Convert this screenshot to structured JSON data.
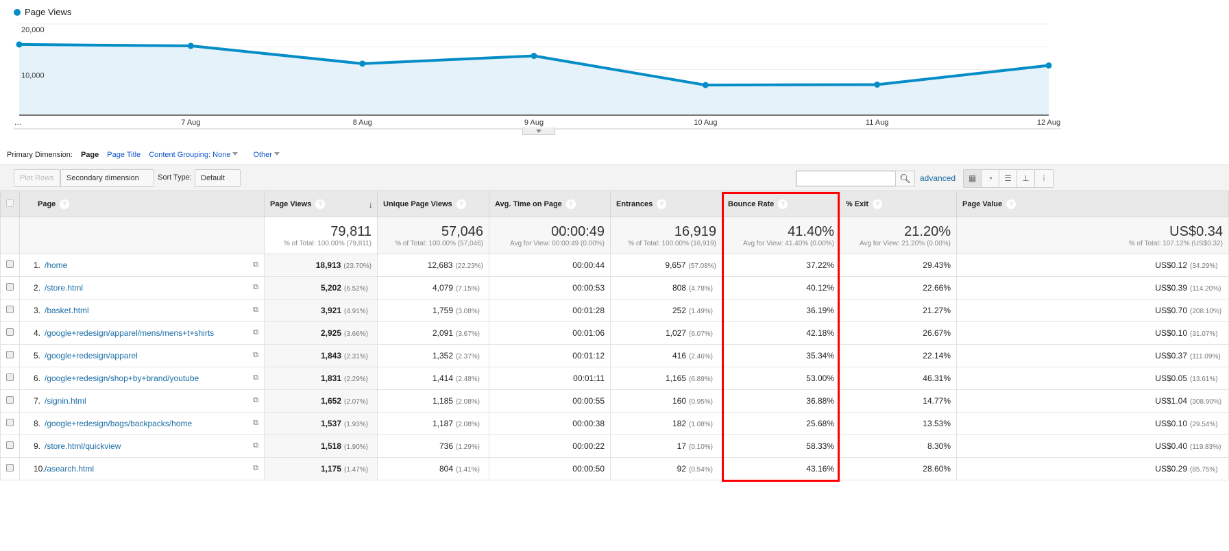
{
  "chart_data": {
    "type": "area",
    "series": [
      {
        "name": "Page Views",
        "values": [
          15500,
          15200,
          11300,
          13000,
          6600,
          6700,
          10900
        ]
      }
    ],
    "x_labels": [
      "…",
      "7 Aug",
      "8 Aug",
      "9 Aug",
      "10 Aug",
      "11 Aug",
      "12 Aug"
    ],
    "y_ticks": [
      "20,000",
      "10,000"
    ],
    "ylim": [
      0,
      20000
    ],
    "grid": true,
    "legend": "top-left",
    "color": "#058dc7"
  },
  "dimension": {
    "label": "Primary Dimension:",
    "selected": "Page",
    "options": [
      "Page Title",
      "Content Grouping: None",
      "Other"
    ]
  },
  "toolbar": {
    "plot_rows": "Plot Rows",
    "secondary": "Secondary dimension",
    "sort_label": "Sort Type:",
    "sort_value": "Default",
    "search_value": "",
    "advanced": "advanced"
  },
  "columns": [
    "Page",
    "Page Views",
    "Unique Page Views",
    "Avg. Time on Page",
    "Entrances",
    "Bounce Rate",
    "% Exit",
    "Page Value"
  ],
  "summary": [
    {
      "value": "79,811",
      "sub": "% of Total: 100.00% (79,811)"
    },
    {
      "value": "57,046",
      "sub": "% of Total: 100.00% (57,046)"
    },
    {
      "value": "00:00:49",
      "sub": "Avg for View: 00:00:49 (0.00%)"
    },
    {
      "value": "16,919",
      "sub": "% of Total: 100.00% (16,919)"
    },
    {
      "value": "41.40%",
      "sub": "Avg for View: 41.40% (0.00%)"
    },
    {
      "value": "21.20%",
      "sub": "Avg for View: 21.20% (0.00%)"
    },
    {
      "value": "US$0.34",
      "sub": "% of Total: 107.12% (US$0.32)"
    }
  ],
  "rows": [
    {
      "n": "1.",
      "page": "/home",
      "pv": "18,913",
      "pvp": "(23.70%)",
      "upv": "12,683",
      "upvp": "(22.23%)",
      "t": "00:00:44",
      "e": "9,657",
      "ep": "(57.08%)",
      "br": "37.22%",
      "ex": "29.43%",
      "val": "US$0.12",
      "valp": "(34.29%)"
    },
    {
      "n": "2.",
      "page": "/store.html",
      "pv": "5,202",
      "pvp": "(6.52%)",
      "upv": "4,079",
      "upvp": "(7.15%)",
      "t": "00:00:53",
      "e": "808",
      "ep": "(4.78%)",
      "br": "40.12%",
      "ex": "22.66%",
      "val": "US$0.39",
      "valp": "(114.20%)"
    },
    {
      "n": "3.",
      "page": "/basket.html",
      "pv": "3,921",
      "pvp": "(4.91%)",
      "upv": "1,759",
      "upvp": "(3.08%)",
      "t": "00:01:28",
      "e": "252",
      "ep": "(1.49%)",
      "br": "36.19%",
      "ex": "21.27%",
      "val": "US$0.70",
      "valp": "(208.10%)"
    },
    {
      "n": "4.",
      "page": "/google+redesign/apparel/mens/mens+t+shirts",
      "pv": "2,925",
      "pvp": "(3.66%)",
      "upv": "2,091",
      "upvp": "(3.67%)",
      "t": "00:01:06",
      "e": "1,027",
      "ep": "(6.07%)",
      "br": "42.18%",
      "ex": "26.67%",
      "val": "US$0.10",
      "valp": "(31.07%)"
    },
    {
      "n": "5.",
      "page": "/google+redesign/apparel",
      "pv": "1,843",
      "pvp": "(2.31%)",
      "upv": "1,352",
      "upvp": "(2.37%)",
      "t": "00:01:12",
      "e": "416",
      "ep": "(2.46%)",
      "br": "35.34%",
      "ex": "22.14%",
      "val": "US$0.37",
      "valp": "(111.09%)"
    },
    {
      "n": "6.",
      "page": "/google+redesign/shop+by+brand/youtube",
      "pv": "1,831",
      "pvp": "(2.29%)",
      "upv": "1,414",
      "upvp": "(2.48%)",
      "t": "00:01:11",
      "e": "1,165",
      "ep": "(6.89%)",
      "br": "53.00%",
      "ex": "46.31%",
      "val": "US$0.05",
      "valp": "(13.61%)"
    },
    {
      "n": "7.",
      "page": "/signin.html",
      "pv": "1,652",
      "pvp": "(2.07%)",
      "upv": "1,185",
      "upvp": "(2.08%)",
      "t": "00:00:55",
      "e": "160",
      "ep": "(0.95%)",
      "br": "36.88%",
      "ex": "14.77%",
      "val": "US$1.04",
      "valp": "(308.90%)"
    },
    {
      "n": "8.",
      "page": "/google+redesign/bags/backpacks/home",
      "pv": "1,537",
      "pvp": "(1.93%)",
      "upv": "1,187",
      "upvp": "(2.08%)",
      "t": "00:00:38",
      "e": "182",
      "ep": "(1.08%)",
      "br": "25.68%",
      "ex": "13.53%",
      "val": "US$0.10",
      "valp": "(29.54%)"
    },
    {
      "n": "9.",
      "page": "/store.html/quickview",
      "pv": "1,518",
      "pvp": "(1.90%)",
      "upv": "736",
      "upvp": "(1.29%)",
      "t": "00:00:22",
      "e": "17",
      "ep": "(0.10%)",
      "br": "58.33%",
      "ex": "8.30%",
      "val": "US$0.40",
      "valp": "(119.83%)"
    },
    {
      "n": "10.",
      "page": "/asearch.html",
      "pv": "1,175",
      "pvp": "(1.47%)",
      "upv": "804",
      "upvp": "(1.41%)",
      "t": "00:00:50",
      "e": "92",
      "ep": "(0.54%)",
      "br": "43.16%",
      "ex": "28.60%",
      "val": "US$0.29",
      "valp": "(85.75%)"
    }
  ]
}
